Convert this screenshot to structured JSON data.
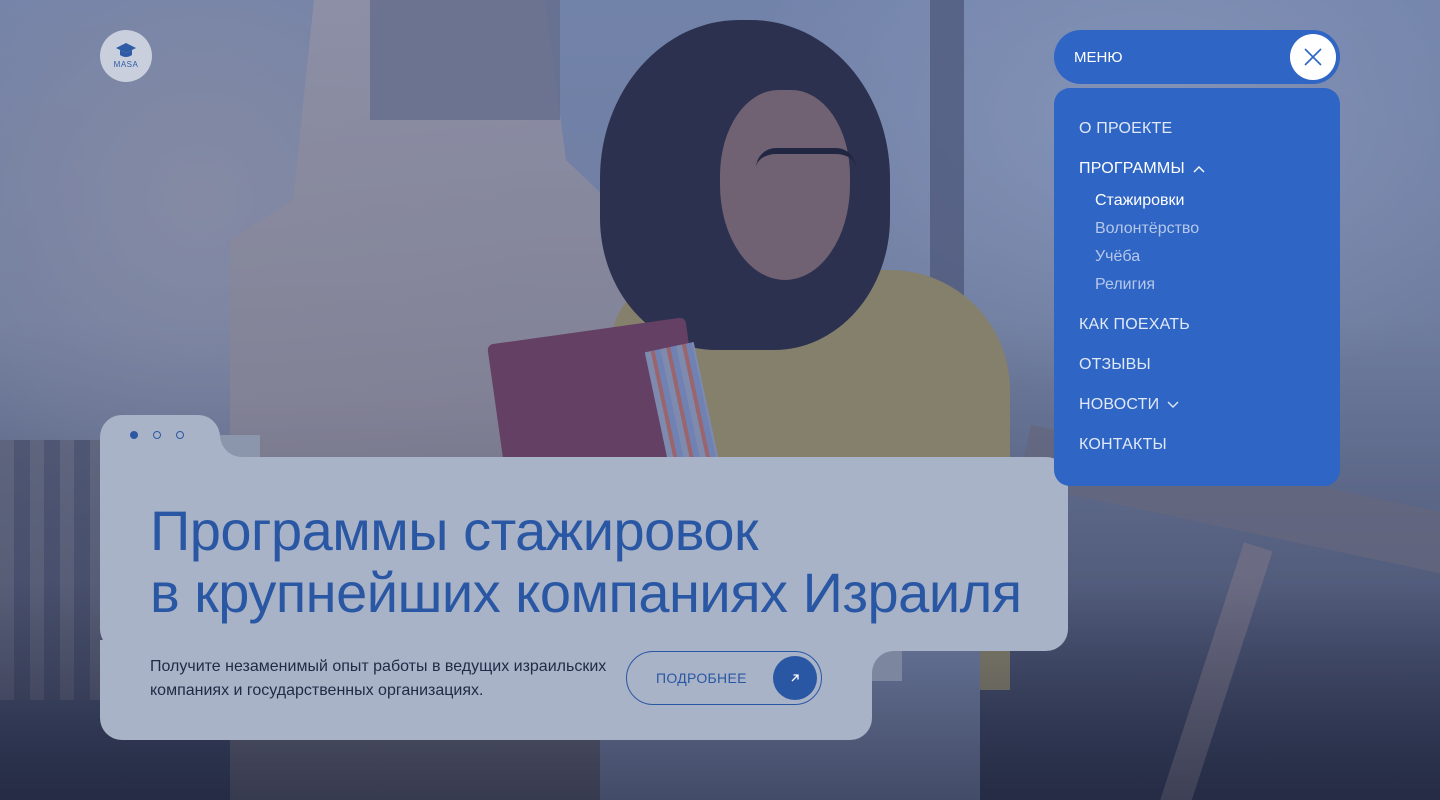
{
  "logo": {
    "text": "MASA"
  },
  "hero": {
    "title_line1": "Программы стажировок",
    "title_line2": "в крупнейших компаниях Израиля",
    "description": "Получите незаменимый опыт работы в ведущих израильских компаниях и государственных организациях.",
    "more_label": "ПОДРОБНЕЕ",
    "slides": {
      "count": 3,
      "active": 1
    }
  },
  "menu": {
    "label": "МЕНЮ",
    "items": [
      {
        "label": "О ПРОЕКТЕ"
      },
      {
        "label": "ПРОГРАММЫ",
        "expanded": true,
        "children": [
          {
            "label": "Стажировки",
            "active": true
          },
          {
            "label": "Волонтёрство"
          },
          {
            "label": "Учёба"
          },
          {
            "label": "Религия"
          }
        ]
      },
      {
        "label": "КАК ПОЕХАТЬ"
      },
      {
        "label": "ОТЗЫВЫ"
      },
      {
        "label": "НОВОСТИ",
        "expanded": false
      },
      {
        "label": "КОНТАКТЫ"
      }
    ]
  },
  "colors": {
    "accent": "#2f65c4",
    "title": "#2a57a4",
    "card": "#a9b3c7"
  }
}
